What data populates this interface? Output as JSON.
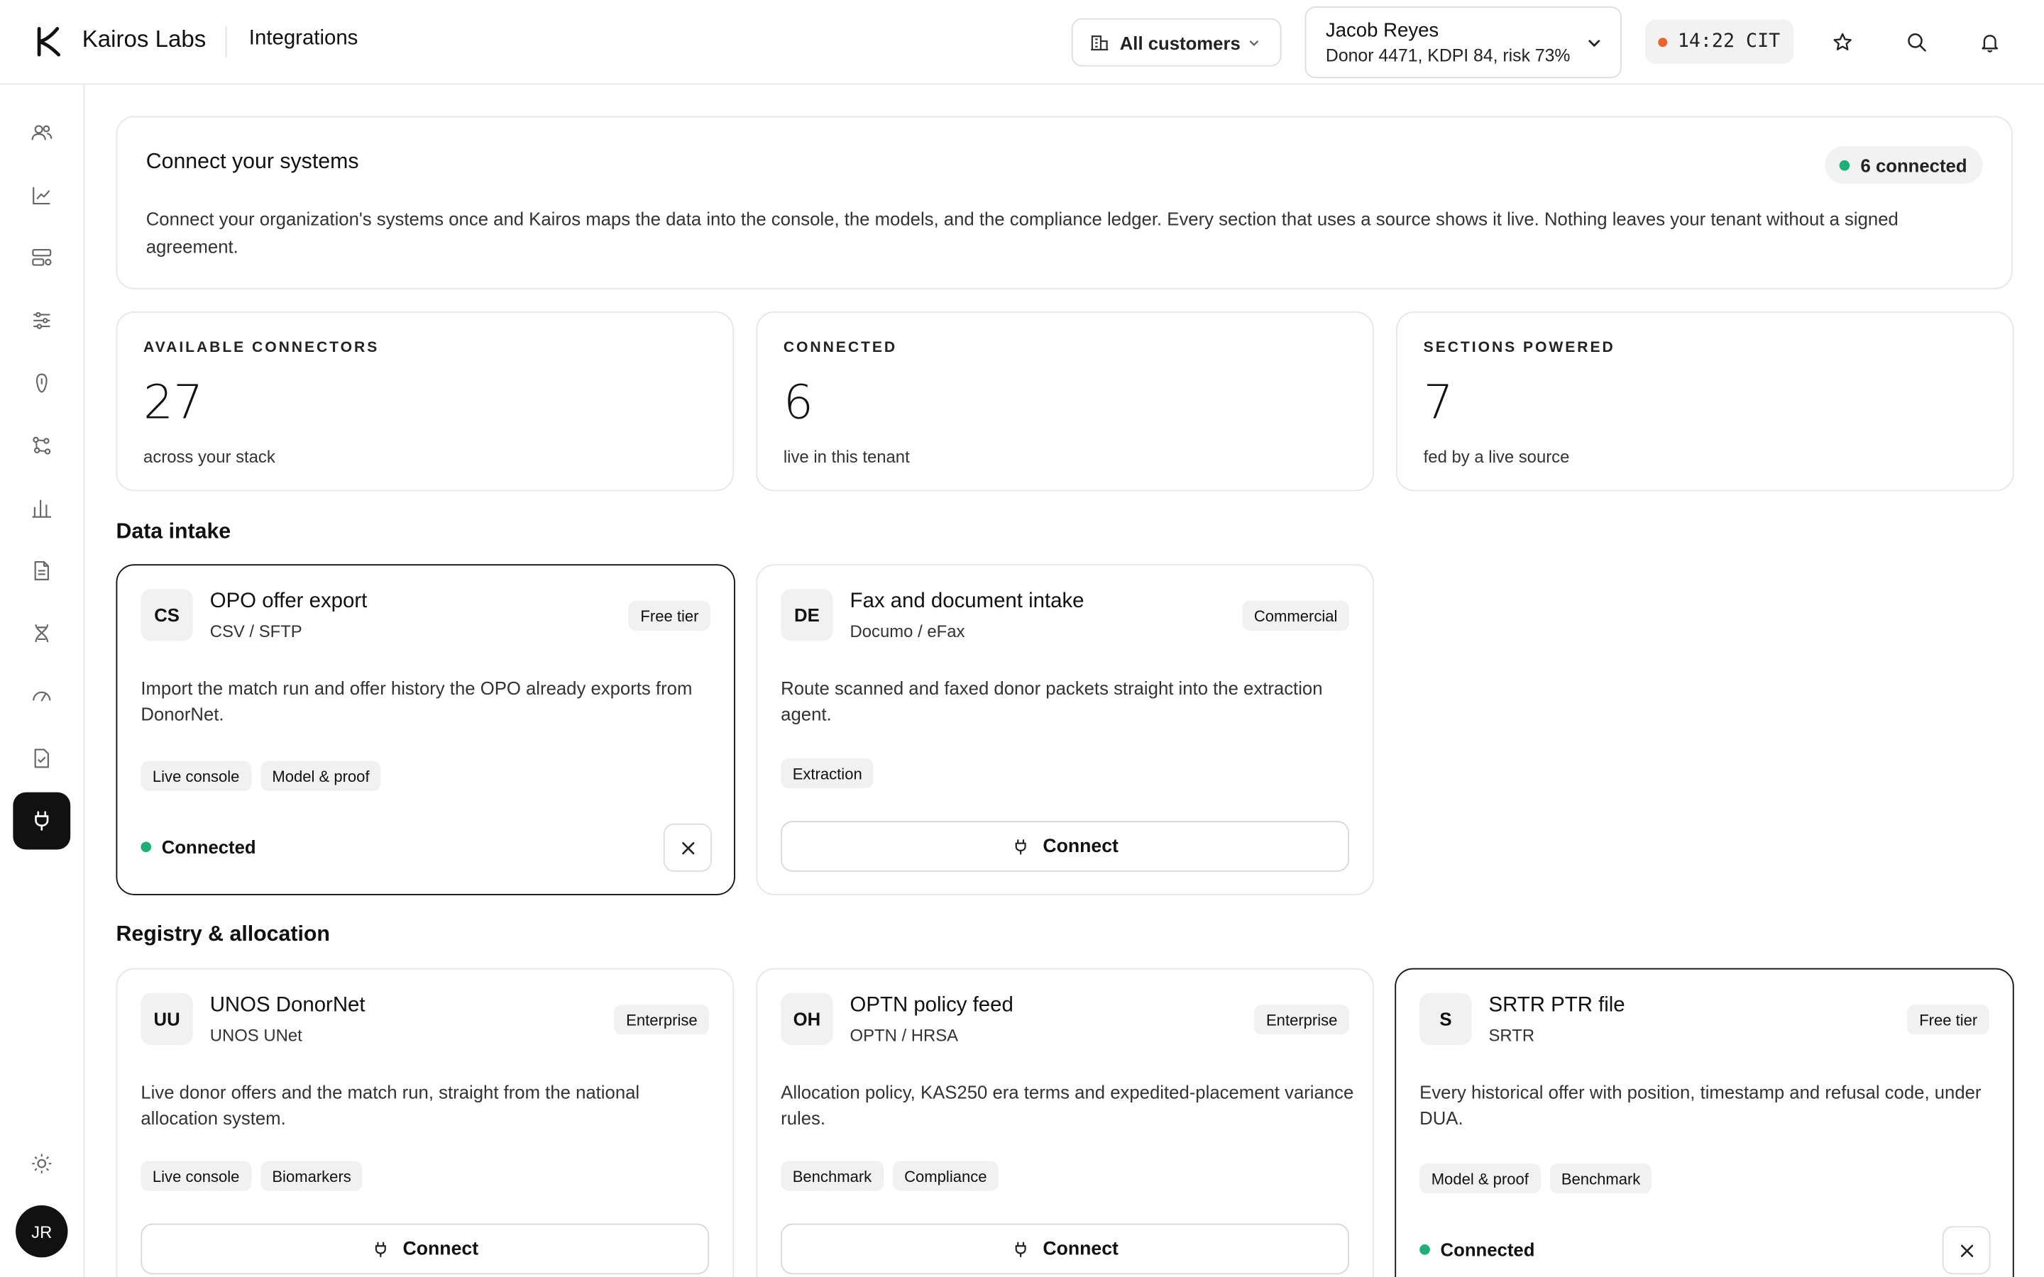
{
  "app": {
    "brand": "Kairos Labs",
    "page": "Integrations"
  },
  "header": {
    "customer_filter": "All customers",
    "patient_name": "Jacob Reyes",
    "patient_meta": "Donor 4471, KDPI 84, risk 73%",
    "clock": "14:22 CIT",
    "status_dot_color": "#e8622c"
  },
  "sidebar": {
    "items": [
      "users-icon",
      "trend-icon",
      "queue-icon",
      "sliders-icon",
      "kidney-icon",
      "network-icon",
      "bar-chart-icon",
      "document-icon",
      "dna-icon",
      "gauge-icon",
      "checklist-icon",
      "plug-icon"
    ],
    "active": "plug-icon",
    "settings": "sun-icon",
    "avatar": "JR"
  },
  "intro": {
    "title": "Connect your systems",
    "connected_pill": "6 connected",
    "description": "Connect your organization's systems once and Kairos maps the data into the console, the models, and the compliance ledger. Every section that uses a source shows it live. Nothing leaves your tenant without a signed agreement."
  },
  "stats": [
    {
      "label": "AVAILABLE CONNECTORS",
      "value": "27",
      "sub": "across your stack"
    },
    {
      "label": "CONNECTED",
      "value": "6",
      "sub": "live in this tenant"
    },
    {
      "label": "SECTIONS POWERED",
      "value": "7",
      "sub": "fed by a live source"
    }
  ],
  "sections": {
    "data_intake": "Data intake",
    "registry": "Registry & allocation"
  },
  "connectors": {
    "opo": {
      "badge": "CS",
      "name": "OPO offer export",
      "vendor": "CSV / SFTP",
      "tier": "Free tier",
      "desc": "Import the match run and offer history the OPO already exports from DonorNet.",
      "tags": [
        "Live console",
        "Model & proof"
      ],
      "status": "Connected"
    },
    "fax": {
      "badge": "DE",
      "name": "Fax and document intake",
      "vendor": "Documo / eFax",
      "tier": "Commercial",
      "desc": "Route scanned and faxed donor packets straight into the extraction agent.",
      "tags": [
        "Extraction"
      ],
      "action": "Connect"
    },
    "unos": {
      "badge": "UU",
      "name": "UNOS DonorNet",
      "vendor": "UNOS UNet",
      "tier": "Enterprise",
      "desc": "Live donor offers and the match run, straight from the national allocation system.",
      "tags": [
        "Live console",
        "Biomarkers"
      ],
      "action": "Connect"
    },
    "optn": {
      "badge": "OH",
      "name": "OPTN policy feed",
      "vendor": "OPTN / HRSA",
      "tier": "Enterprise",
      "desc": "Allocation policy, KAS250 era terms and expedited-placement variance rules.",
      "tags": [
        "Benchmark",
        "Compliance"
      ],
      "action": "Connect"
    },
    "srtr": {
      "badge": "S",
      "name": "SRTR PTR file",
      "vendor": "SRTR",
      "tier": "Free tier",
      "desc": "Every historical offer with position, timestamp and refusal code, under DUA.",
      "tags": [
        "Model & proof",
        "Benchmark"
      ],
      "status": "Connected"
    }
  },
  "colors": {
    "connected": "#1fb07a",
    "accent_dark": "#111111"
  }
}
